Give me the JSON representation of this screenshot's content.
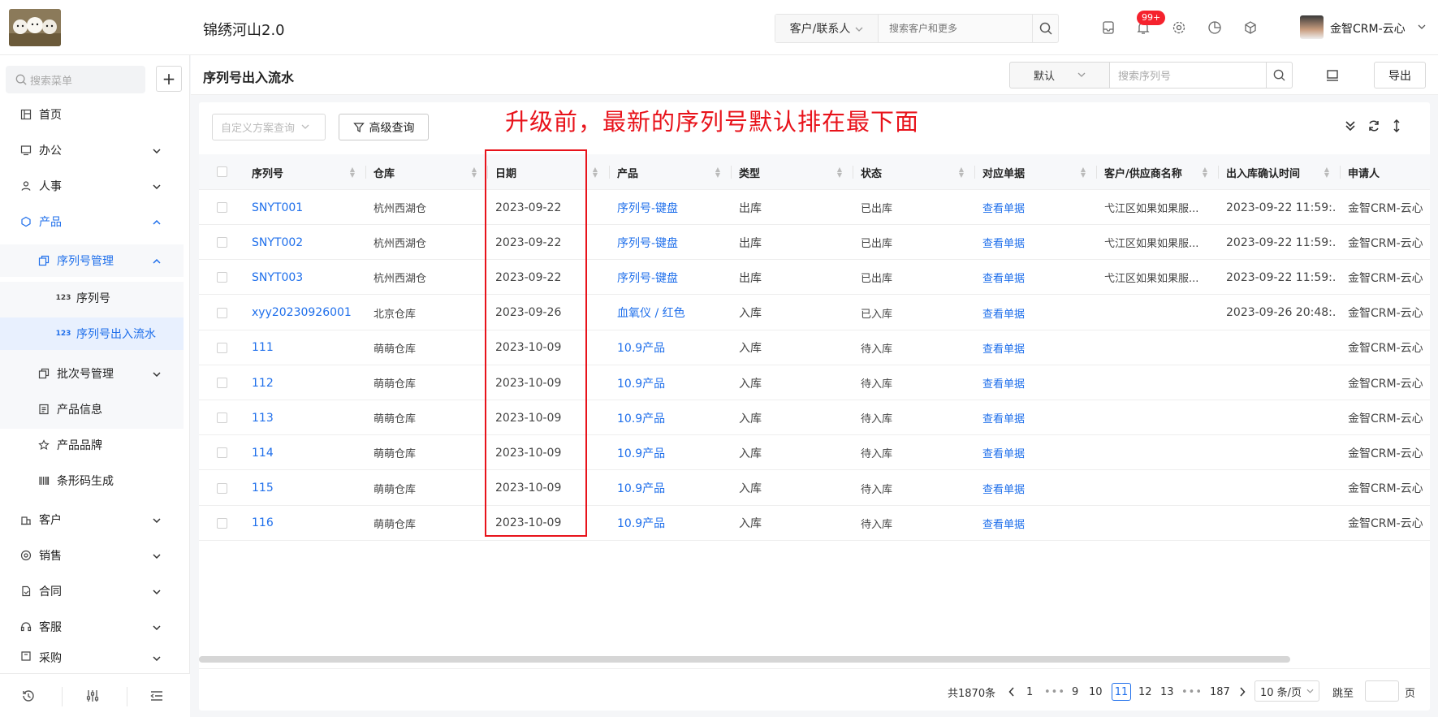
{
  "header": {
    "app_title": "锦绣河山2.0",
    "search_type": "客户/联系人",
    "search_placeholder": "搜索客户和更多",
    "notification_badge": "99+",
    "user_name": "金智CRM-云心"
  },
  "sidebar": {
    "search_placeholder": "搜索菜单",
    "add_label": "+",
    "items": [
      {
        "label": "首页",
        "icon": "home-icon"
      },
      {
        "label": "办公",
        "icon": "office-icon"
      },
      {
        "label": "人事",
        "icon": "people-icon"
      },
      {
        "label": "产品",
        "icon": "product-icon"
      },
      {
        "label": "序列号管理",
        "icon": "copy-icon"
      },
      {
        "label": "序列号",
        "icon": "number-icon"
      },
      {
        "label": "序列号出入流水",
        "icon": "number-icon"
      },
      {
        "label": "批次号管理",
        "icon": "copy-icon"
      },
      {
        "label": "产品信息",
        "icon": "doc-icon"
      },
      {
        "label": "产品品牌",
        "icon": "star-icon"
      },
      {
        "label": "条形码生成",
        "icon": "barcode-icon"
      },
      {
        "label": "客户",
        "icon": "building-icon"
      },
      {
        "label": "销售",
        "icon": "sales-icon"
      },
      {
        "label": "合同",
        "icon": "contract-icon"
      },
      {
        "label": "客服",
        "icon": "service-icon"
      },
      {
        "label": "采购",
        "icon": "purchase-icon"
      }
    ]
  },
  "page": {
    "title": "序列号出入流水",
    "sort_value": "默认",
    "sn_search_placeholder": "搜索序列号",
    "export_label": "导出",
    "scheme_placeholder": "自定义方案查询",
    "advanced_label": "高级查询",
    "annotation": "升级前，最新的序列号默认排在最下面"
  },
  "table": {
    "columns": [
      "序列号",
      "仓库",
      "日期",
      "产品",
      "类型",
      "状态",
      "对应单据",
      "客户/供应商名称",
      "出入库确认时间",
      "申请人"
    ],
    "rows": [
      [
        "SNYT001",
        "杭州西湖仓",
        "2023-09-22",
        "序列号-键盘",
        "出库",
        "已出库",
        "查看单据",
        "弋江区如果如果服...",
        "2023-09-22 11:59:...",
        "金智CRM-云心"
      ],
      [
        "SNYT002",
        "杭州西湖仓",
        "2023-09-22",
        "序列号-键盘",
        "出库",
        "已出库",
        "查看单据",
        "弋江区如果如果服...",
        "2023-09-22 11:59:...",
        "金智CRM-云心"
      ],
      [
        "SNYT003",
        "杭州西湖仓",
        "2023-09-22",
        "序列号-键盘",
        "出库",
        "已出库",
        "查看单据",
        "弋江区如果如果服...",
        "2023-09-22 11:59:...",
        "金智CRM-云心"
      ],
      [
        "xyy20230926001",
        "北京仓库",
        "2023-09-26",
        "血氧仪 / 红色",
        "入库",
        "已入库",
        "查看单据",
        "",
        "2023-09-26 20:48:...",
        "金智CRM-云心"
      ],
      [
        "111",
        "萌萌仓库",
        "2023-10-09",
        "10.9产品",
        "入库",
        "待入库",
        "查看单据",
        "",
        "",
        "金智CRM-云心"
      ],
      [
        "112",
        "萌萌仓库",
        "2023-10-09",
        "10.9产品",
        "入库",
        "待入库",
        "查看单据",
        "",
        "",
        "金智CRM-云心"
      ],
      [
        "113",
        "萌萌仓库",
        "2023-10-09",
        "10.9产品",
        "入库",
        "待入库",
        "查看单据",
        "",
        "",
        "金智CRM-云心"
      ],
      [
        "114",
        "萌萌仓库",
        "2023-10-09",
        "10.9产品",
        "入库",
        "待入库",
        "查看单据",
        "",
        "",
        "金智CRM-云心"
      ],
      [
        "115",
        "萌萌仓库",
        "2023-10-09",
        "10.9产品",
        "入库",
        "待入库",
        "查看单据",
        "",
        "",
        "金智CRM-云心"
      ],
      [
        "116",
        "萌萌仓库",
        "2023-10-09",
        "10.9产品",
        "入库",
        "待入库",
        "查看单据",
        "",
        "",
        "金智CRM-云心"
      ]
    ]
  },
  "pagination": {
    "total": "共1870条",
    "pages": [
      "1",
      "•••",
      "9",
      "10",
      "11",
      "12",
      "13",
      "•••",
      "187"
    ],
    "current": "11",
    "page_size": "10 条/页",
    "jump_label": "跳至",
    "page_suffix": "页"
  },
  "colors": {
    "accent": "#1f6feb",
    "annotation": "#e8131b",
    "badge": "#f5222d"
  }
}
